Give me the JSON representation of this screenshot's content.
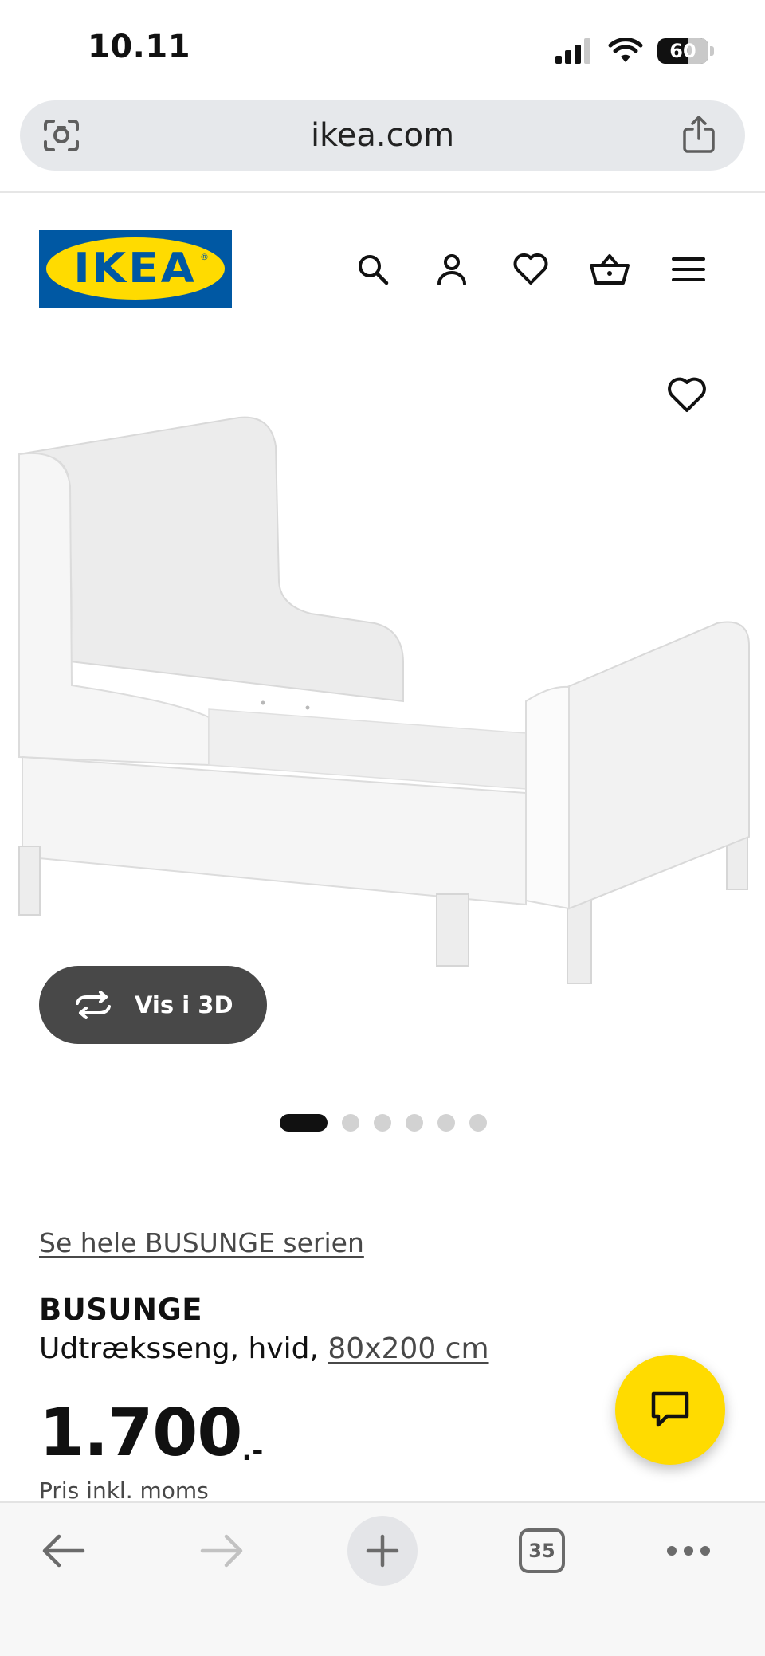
{
  "status_bar": {
    "time": "10.11",
    "battery_level": "60",
    "icons": [
      "signal-icon",
      "wifi-icon",
      "battery-icon"
    ]
  },
  "browser": {
    "url": "ikea.com",
    "left_icon": "visual-search-icon",
    "right_icon": "share-icon",
    "tab_count": "35"
  },
  "site_header": {
    "logo_text": "IKEA",
    "icons": [
      "search-icon",
      "user-icon",
      "heart-icon",
      "cart-icon",
      "menu-icon"
    ]
  },
  "product": {
    "view_3d_label": "Vis i 3D",
    "carousel": {
      "total": 6,
      "active": 1
    },
    "series_link": "Se hele BUSUNGE serien",
    "name": "BUSUNGE",
    "description": "Udtræksseng, hvid, ",
    "size": "80x200 cm",
    "price": "1.700",
    "price_suffix": ".-",
    "price_note": "Pris inkl. moms"
  },
  "colors": {
    "ikea_blue": "#0058a3",
    "ikea_yellow": "#ffdb00",
    "dark_button": "#484848",
    "url_bar_bg": "#e6e8eb"
  }
}
